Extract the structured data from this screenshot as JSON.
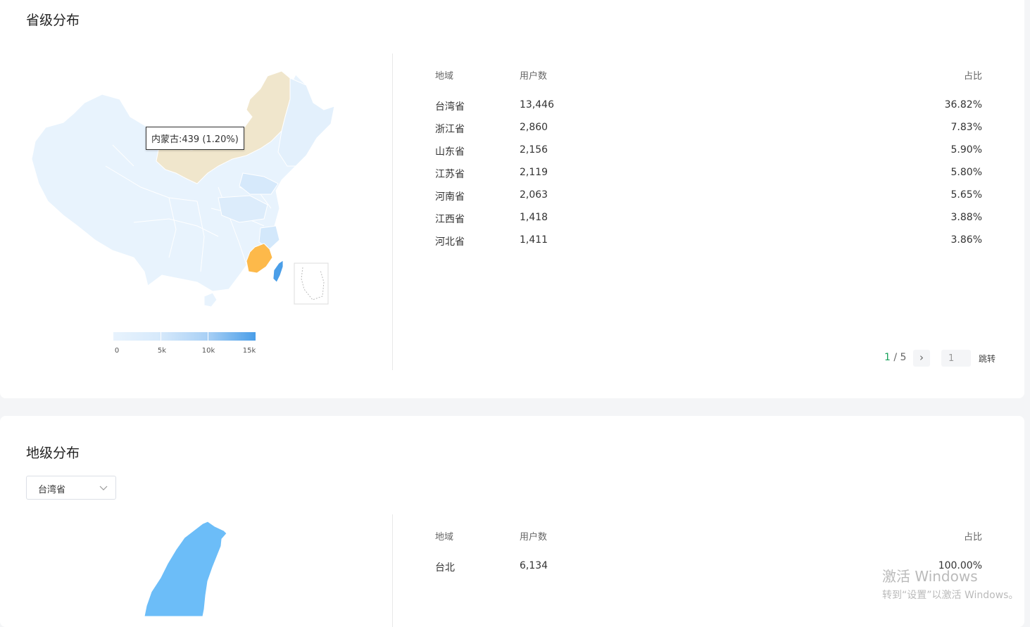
{
  "province": {
    "title": "省级分布",
    "tooltip": "内蒙古:439 (1.20%)",
    "legend": {
      "ticks": [
        "0",
        "5k",
        "10k",
        "15k"
      ],
      "max": 15000
    },
    "table": {
      "headers": {
        "region": "地域",
        "users": "用户数",
        "pct": "占比"
      },
      "rows": [
        {
          "region": "台湾省",
          "users": "13,446",
          "pct": "36.82%"
        },
        {
          "region": "浙江省",
          "users": "2,860",
          "pct": "7.83%"
        },
        {
          "region": "山东省",
          "users": "2,156",
          "pct": "5.90%"
        },
        {
          "region": "江苏省",
          "users": "2,119",
          "pct": "5.80%"
        },
        {
          "region": "河南省",
          "users": "2,063",
          "pct": "5.65%"
        },
        {
          "region": "江西省",
          "users": "1,418",
          "pct": "3.88%"
        },
        {
          "region": "河北省",
          "users": "1,411",
          "pct": "3.86%"
        }
      ]
    },
    "pager": {
      "current": "1",
      "total": "/ 5",
      "next_icon": "›",
      "input_value": "1",
      "jump_label": "跳转"
    }
  },
  "city": {
    "title": "地级分布",
    "select_value": "台湾省",
    "table": {
      "headers": {
        "region": "地域",
        "users": "用户数",
        "pct": "占比"
      },
      "rows": [
        {
          "region": "台北",
          "users": "6,134",
          "pct": "100.00%"
        }
      ]
    }
  },
  "colors": {
    "highlight_province": "#f0e6cc",
    "selected_province": "#fdb94a",
    "taiwan": "#4a9ee8",
    "base_province": "#e8f3fd",
    "pager_current": "#17a25a"
  },
  "watermark": {
    "line1": "激活 Windows",
    "line2": "转到“设置”以激活 Windows。"
  }
}
